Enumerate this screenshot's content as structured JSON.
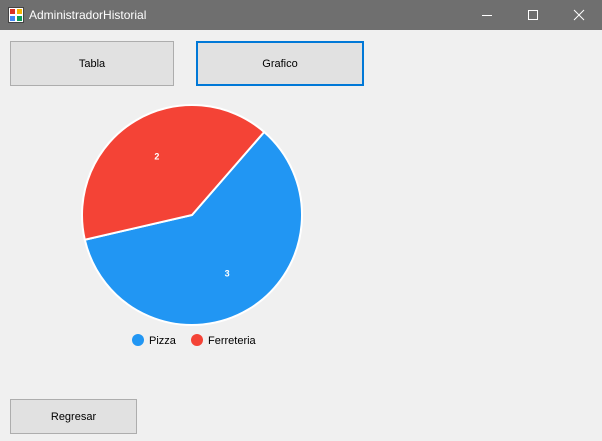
{
  "window": {
    "title": "AdministradorHistorial",
    "controls": [
      "minimize",
      "maximize",
      "close"
    ]
  },
  "buttons": {
    "tabla": "Tabla",
    "grafico": "Grafico",
    "regresar": "Regresar"
  },
  "colors": {
    "titlebar": "#6f6f6f",
    "pizza": "#2196f3",
    "ferreteria": "#f44336",
    "focus_border": "#0078d7"
  },
  "chart_data": {
    "type": "pie",
    "categories": [
      "Pizza",
      "Ferreteria"
    ],
    "values": [
      3,
      2
    ],
    "colors": [
      "#2196f3",
      "#f44336"
    ],
    "data_labels": [
      "3",
      "2"
    ],
    "legend": "bottom",
    "title": ""
  }
}
